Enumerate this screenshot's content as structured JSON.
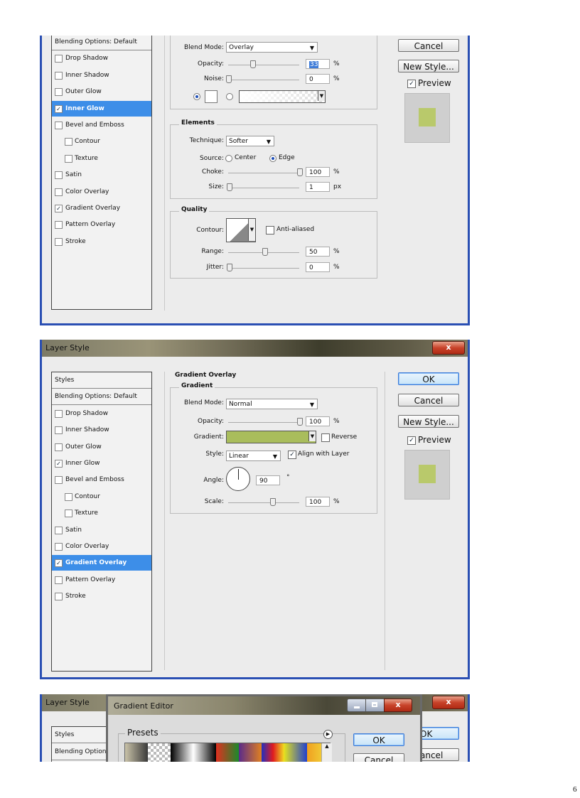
{
  "shot1": {
    "items": [
      {
        "label": "Blending Options: Default",
        "checkbox": false,
        "checked": false,
        "selected": false,
        "indent": false,
        "header": true
      },
      {
        "label": "Drop Shadow",
        "checkbox": true,
        "checked": false,
        "selected": false,
        "indent": false
      },
      {
        "label": "Inner Shadow",
        "checkbox": true,
        "checked": false,
        "selected": false,
        "indent": false
      },
      {
        "label": "Outer Glow",
        "checkbox": true,
        "checked": false,
        "selected": false,
        "indent": false
      },
      {
        "label": "Inner Glow",
        "checkbox": true,
        "checked": true,
        "selected": true,
        "indent": false
      },
      {
        "label": "Bevel and Emboss",
        "checkbox": true,
        "checked": false,
        "selected": false,
        "indent": false
      },
      {
        "label": "Contour",
        "checkbox": true,
        "checked": false,
        "selected": false,
        "indent": true
      },
      {
        "label": "Texture",
        "checkbox": true,
        "checked": false,
        "selected": false,
        "indent": true
      },
      {
        "label": "Satin",
        "checkbox": true,
        "checked": false,
        "selected": false,
        "indent": false
      },
      {
        "label": "Color Overlay",
        "checkbox": true,
        "checked": false,
        "selected": false,
        "indent": false
      },
      {
        "label": "Gradient Overlay",
        "checkbox": true,
        "checked": true,
        "selected": false,
        "indent": false
      },
      {
        "label": "Pattern Overlay",
        "checkbox": true,
        "checked": false,
        "selected": false,
        "indent": false
      },
      {
        "label": "Stroke",
        "checkbox": true,
        "checked": false,
        "selected": false,
        "indent": false
      }
    ],
    "blend_mode_label": "Blend Mode:",
    "blend_mode": "Overlay",
    "opacity_label": "Opacity:",
    "opacity": "33",
    "noise_label": "Noise:",
    "noise": "0",
    "percent": "%",
    "elements_title": "Elements",
    "technique_label": "Technique:",
    "technique": "Softer",
    "source_label": "Source:",
    "source_center": "Center",
    "source_edge": "Edge",
    "choke_label": "Choke:",
    "choke": "100",
    "size_label": "Size:",
    "size": "1",
    "px": "px",
    "quality_title": "Quality",
    "contour_label": "Contour:",
    "anti_aliased": "Anti-aliased",
    "range_label": "Range:",
    "range": "50",
    "jitter_label": "Jitter:",
    "jitter": "0",
    "cancel": "Cancel",
    "new_style": "New Style...",
    "preview": "Preview"
  },
  "shot2": {
    "title": "Layer Style",
    "close": "x",
    "items": [
      {
        "label": "Styles",
        "checkbox": false,
        "checked": false,
        "selected": false,
        "indent": false,
        "header": true
      },
      {
        "label": "Blending Options: Default",
        "checkbox": false,
        "checked": false,
        "selected": false,
        "indent": false,
        "header": true
      },
      {
        "label": "Drop Shadow",
        "checkbox": true,
        "checked": false,
        "selected": false,
        "indent": false
      },
      {
        "label": "Inner Shadow",
        "checkbox": true,
        "checked": false,
        "selected": false,
        "indent": false
      },
      {
        "label": "Outer Glow",
        "checkbox": true,
        "checked": false,
        "selected": false,
        "indent": false
      },
      {
        "label": "Inner Glow",
        "checkbox": true,
        "checked": true,
        "selected": false,
        "indent": false
      },
      {
        "label": "Bevel and Emboss",
        "checkbox": true,
        "checked": false,
        "selected": false,
        "indent": false
      },
      {
        "label": "Contour",
        "checkbox": true,
        "checked": false,
        "selected": false,
        "indent": true
      },
      {
        "label": "Texture",
        "checkbox": true,
        "checked": false,
        "selected": false,
        "indent": true
      },
      {
        "label": "Satin",
        "checkbox": true,
        "checked": false,
        "selected": false,
        "indent": false
      },
      {
        "label": "Color Overlay",
        "checkbox": true,
        "checked": false,
        "selected": false,
        "indent": false
      },
      {
        "label": "Gradient Overlay",
        "checkbox": true,
        "checked": true,
        "selected": true,
        "indent": false
      },
      {
        "label": "Pattern Overlay",
        "checkbox": true,
        "checked": false,
        "selected": false,
        "indent": false
      },
      {
        "label": "Stroke",
        "checkbox": true,
        "checked": false,
        "selected": false,
        "indent": false
      }
    ],
    "section_title": "Gradient Overlay",
    "sub_title": "Gradient",
    "blend_mode_label": "Blend Mode:",
    "blend_mode": "Normal",
    "opacity_label": "Opacity:",
    "opacity": "100",
    "percent": "%",
    "gradient_label": "Gradient:",
    "reverse": "Reverse",
    "style_label": "Style:",
    "style": "Linear",
    "align": "Align with Layer",
    "angle_label": "Angle:",
    "angle": "90",
    "degree": "°",
    "scale_label": "Scale:",
    "scale": "100",
    "ok": "OK",
    "cancel": "Cancel",
    "new_style": "New Style...",
    "preview": "Preview"
  },
  "shot3": {
    "layer_title": "Layer Style",
    "editor_title": "Gradient Editor",
    "styles": "Styles",
    "blending": "Blending Option",
    "presets": "Presets",
    "ok": "OK",
    "cancel": "Cancel",
    "ok_back": "OK",
    "cancel_back": "ancel",
    "close": "x"
  },
  "page_number": "6",
  "colors": {
    "swatch": "#b9c96b",
    "selection": "#3d8ee8",
    "frame": "#2a4fb3"
  }
}
